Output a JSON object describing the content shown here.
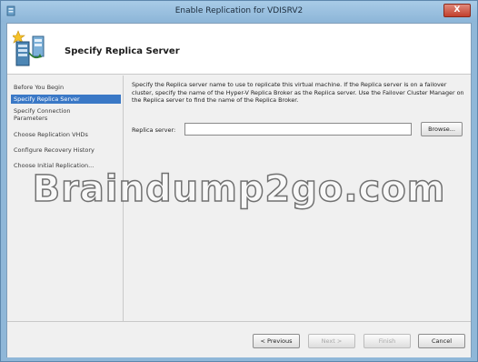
{
  "window": {
    "title": "Enable Replication for VDISRV2",
    "close_label": "X"
  },
  "header": {
    "title": "Specify Replica Server"
  },
  "nav": {
    "items": [
      {
        "label": "Before You Begin",
        "selected": false
      },
      {
        "label": "Specify Replica Server",
        "selected": true
      },
      {
        "label": "Specify Connection Parameters",
        "selected": false
      },
      {
        "label": "Choose Replication VHDs",
        "selected": false
      },
      {
        "label": "Configure Recovery History",
        "selected": false
      },
      {
        "label": "Choose Initial Replication...",
        "selected": false
      }
    ]
  },
  "main": {
    "description": "Specify the Replica server name to use to replicate this virtual machine. If the Replica server is on a failover cluster, specify the name of the Hyper-V Replica Broker as the Replica server. Use the Failover Cluster Manager on the Replica server to find the name of the Replica Broker.",
    "replica_label": "Replica server:",
    "replica_value": "",
    "browse_label": "Browse..."
  },
  "footer": {
    "previous_label": "< Previous",
    "next_label": "Next >",
    "finish_label": "Finish",
    "cancel_label": "Cancel"
  },
  "watermark": {
    "text": "Braindump2go.com"
  },
  "colors": {
    "titlebar": "#8db6d8",
    "selection": "#3a78c6",
    "close": "#c2402c"
  }
}
